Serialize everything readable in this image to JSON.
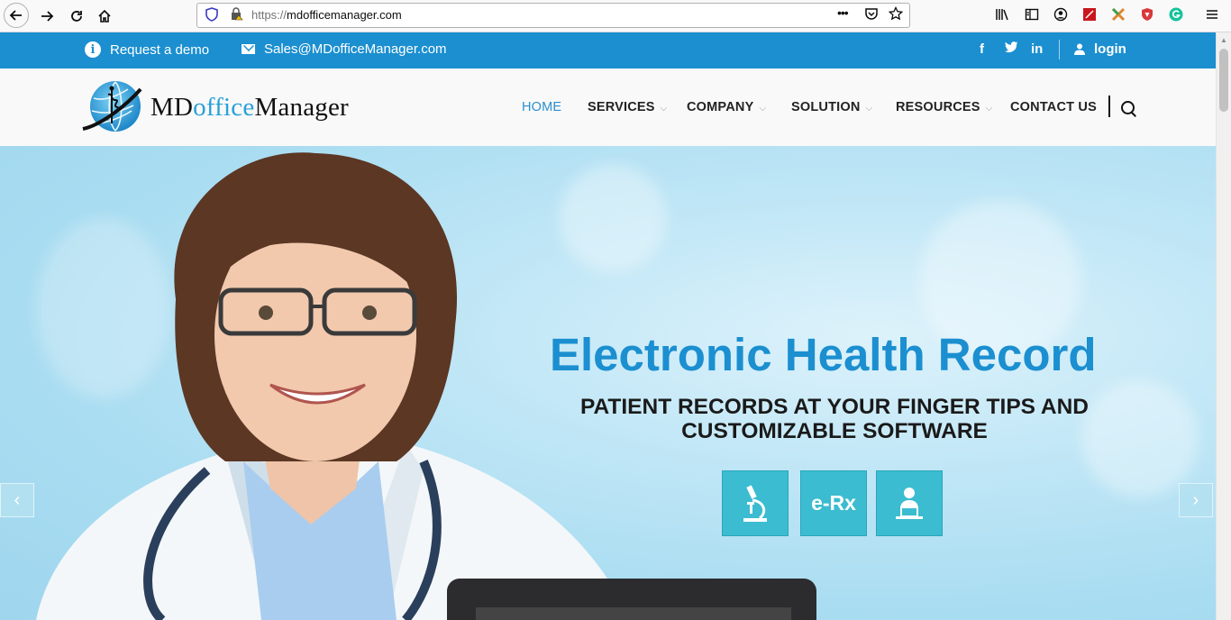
{
  "browser": {
    "url_scheme": "https://",
    "url_host": "mdofficemanager.com",
    "more_label": "•••"
  },
  "topbar": {
    "demo_label": "Request a demo",
    "email_label": "Sales@MDofficeManager.com",
    "social": [
      "f",
      "t",
      "in"
    ],
    "login_label": "login",
    "color": "#1b8fd0"
  },
  "logo": {
    "prefix": "MD",
    "middle": "office",
    "suffix": "Manager"
  },
  "nav": {
    "items": [
      {
        "label": "HOME",
        "active": true
      },
      {
        "label": "SERVICES"
      },
      {
        "label": "COMPANY"
      },
      {
        "label": "SOLUTION"
      },
      {
        "label": "RESOURCES"
      },
      {
        "label": "CONTACT US"
      }
    ]
  },
  "hero": {
    "title": "Electronic Health Record",
    "subtitle_line1": "PATIENT RECORDS AT YOUR FINGER TIPS AND",
    "subtitle_line2": "CUSTOMIZABLE SOFTWARE",
    "tiles": [
      {
        "icon": "microscope-icon"
      },
      {
        "label": "e-Rx"
      },
      {
        "icon": "doctor-laptop-icon"
      }
    ],
    "prev": "‹",
    "next": "›",
    "accent": "#3bbcd0"
  }
}
